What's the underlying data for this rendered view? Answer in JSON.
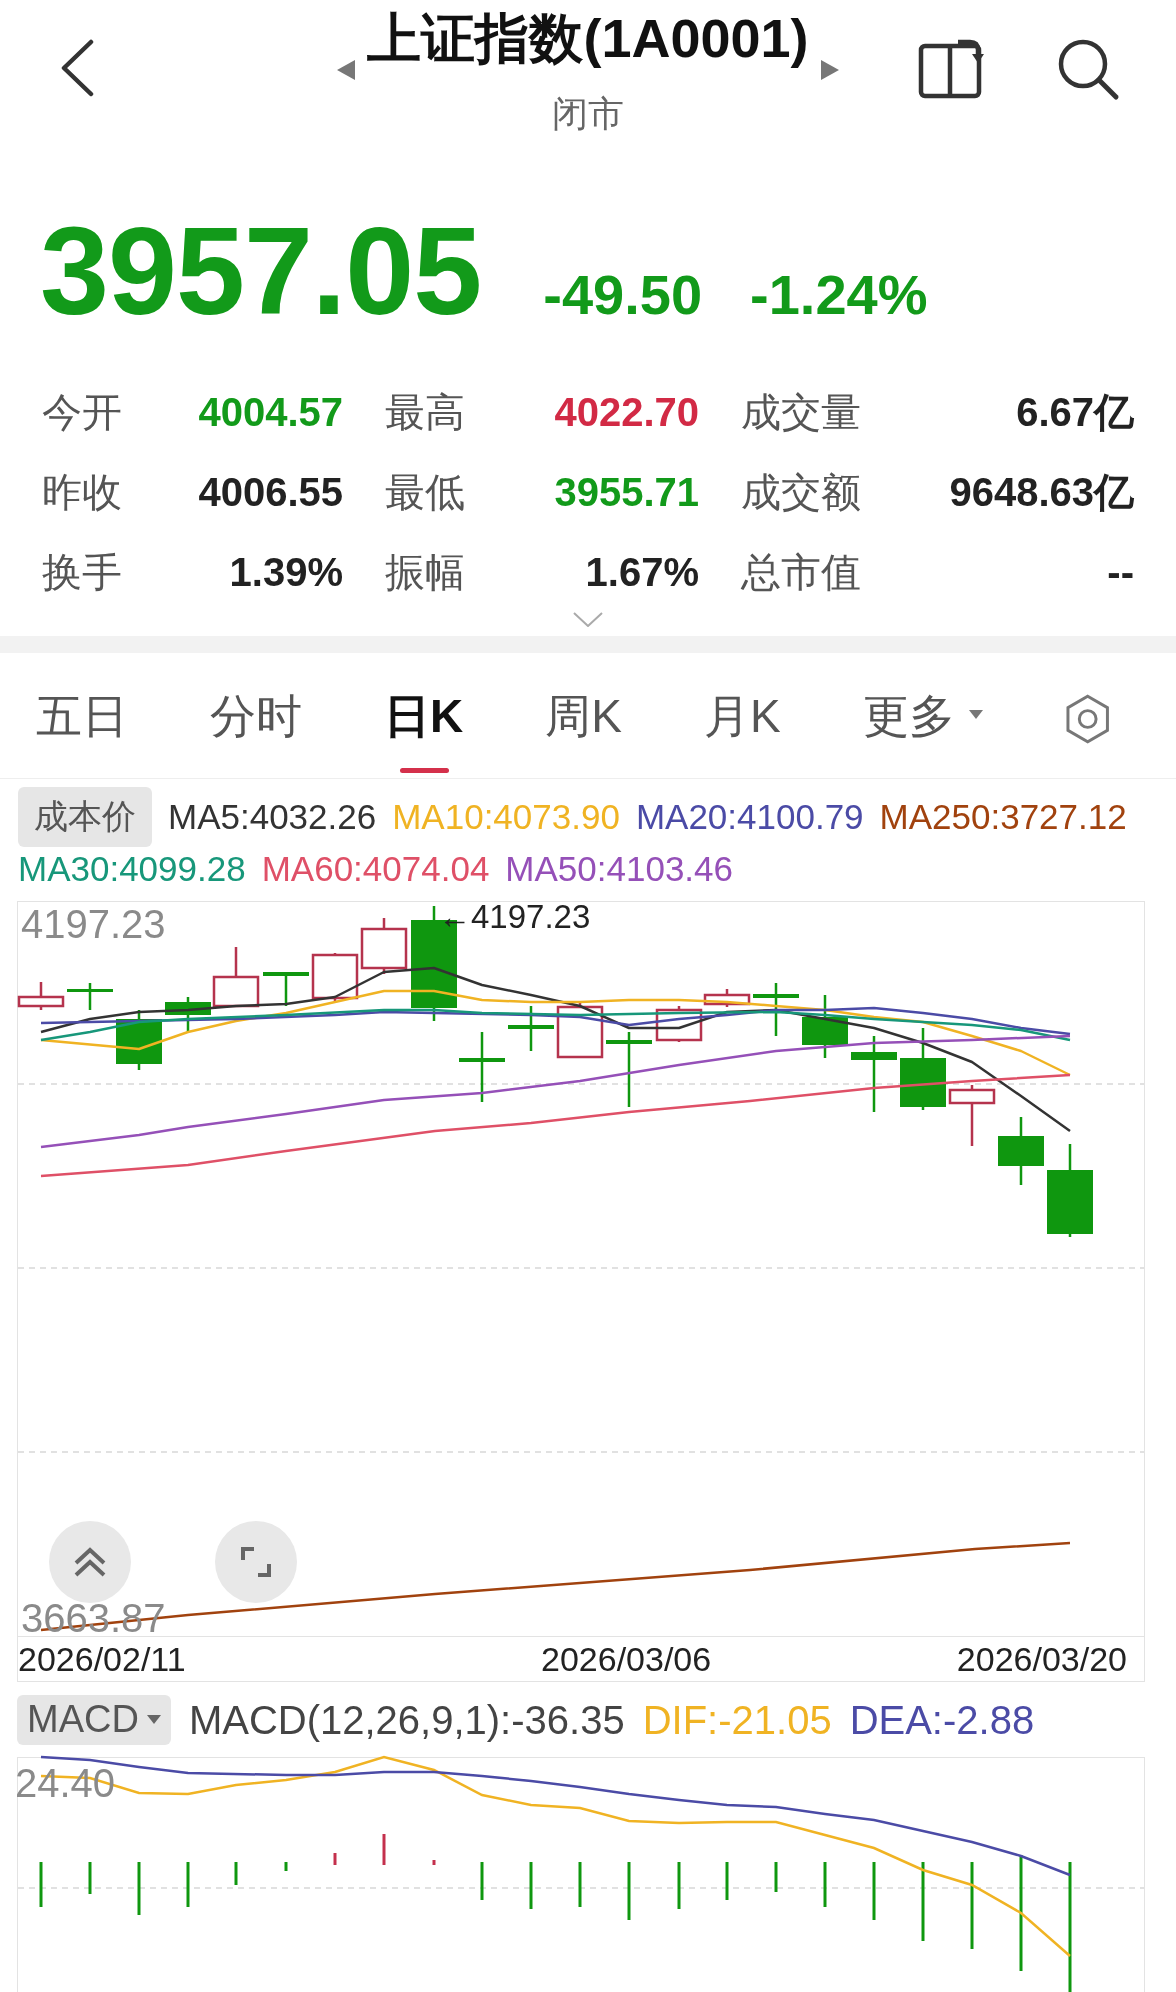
{
  "header": {
    "title": "上证指数(1A0001)",
    "status": "闭市"
  },
  "quote": {
    "price": "3957.05",
    "change": "-49.50",
    "change_percent": "-1.24%",
    "color": "#129a1a"
  },
  "stats": [
    {
      "label": "今开",
      "value": "4004.57",
      "color": "#129a1a"
    },
    {
      "label": "最高",
      "value": "4022.70",
      "color": "#d22a45"
    },
    {
      "label": "成交量",
      "value": "6.67亿",
      "color": "#222222"
    },
    {
      "label": "昨收",
      "value": "4006.55",
      "color": "#222222"
    },
    {
      "label": "最低",
      "value": "3955.71",
      "color": "#129a1a"
    },
    {
      "label": "成交额",
      "value": "9648.63亿",
      "color": "#222222"
    },
    {
      "label": "换手",
      "value": "1.39%",
      "color": "#222222"
    },
    {
      "label": "振幅",
      "value": "1.67%",
      "color": "#222222"
    },
    {
      "label": "总市值",
      "value": "--",
      "color": "#222222"
    }
  ],
  "period_tabs": [
    {
      "label": "五日",
      "selected": false,
      "kind": "tab"
    },
    {
      "label": "分时",
      "selected": false,
      "kind": "tab"
    },
    {
      "label": "日K",
      "selected": true,
      "kind": "tab"
    },
    {
      "label": "周K",
      "selected": false,
      "kind": "tab"
    },
    {
      "label": "月K",
      "selected": false,
      "kind": "tab"
    },
    {
      "label": "更多",
      "selected": false,
      "kind": "dropdown"
    }
  ],
  "kline": {
    "cost_button": "成本价",
    "ma_legend": [
      {
        "text": "MA5:4032.26",
        "color": "#333333"
      },
      {
        "text": "MA10:4073.90",
        "color": "#f0b323"
      },
      {
        "text": "MA20:4100.79",
        "color": "#4b4ba6"
      },
      {
        "text": "MA250:3727.12",
        "color": "#a1420e"
      },
      {
        "text": "MA30:4099.28",
        "color": "#17977a"
      },
      {
        "text": "MA60:4074.04",
        "color": "#df5067"
      },
      {
        "text": "MA50:4103.46",
        "color": "#9550b8"
      }
    ],
    "y_max_label": "4197.23",
    "high_marker": "←4197.23",
    "y_min_label": "3663.87",
    "dates": [
      "2026/02/11",
      "2026/03/06",
      "2026/03/20"
    ]
  },
  "macd": {
    "indicator_button": "MACD",
    "legend": [
      {
        "text": "MACD(12,26,9,1):-36.35",
        "color": "#444444"
      },
      {
        "text": "DIF:-21.05",
        "color": "#f0b323"
      },
      {
        "text": "DEA:-2.88",
        "color": "#4b4ba6"
      }
    ],
    "y_max_label": "24.40"
  }
}
